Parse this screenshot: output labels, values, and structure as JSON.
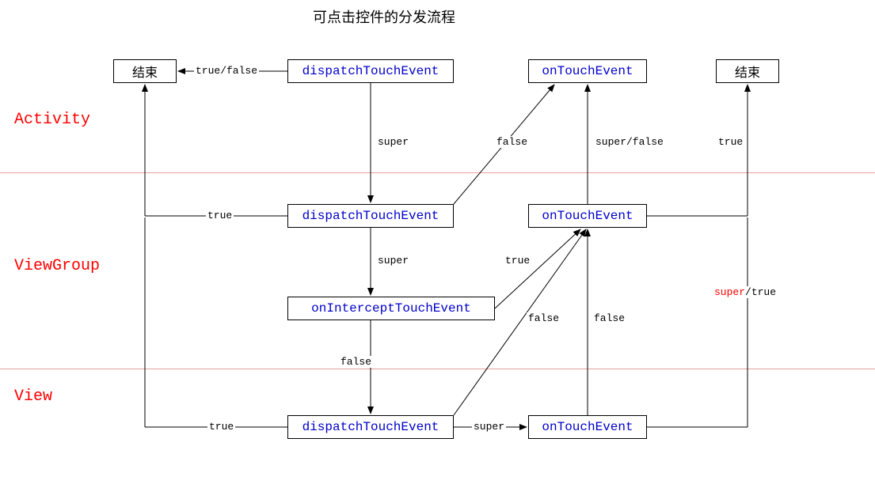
{
  "title": "可点击控件的分发流程",
  "layers": {
    "activity": "Activity",
    "viewgroup": "ViewGroup",
    "view": "View"
  },
  "nodes": {
    "end_left": "结束",
    "end_right": "结束",
    "act_dispatch": "dispatchTouchEvent",
    "act_on_touch": "onTouchEvent",
    "vg_dispatch": "dispatchTouchEvent",
    "vg_intercept": "onInterceptTouchEvent",
    "vg_on_touch": "onTouchEvent",
    "view_dispatch": "dispatchTouchEvent",
    "view_on_touch": "onTouchEvent"
  },
  "edges": {
    "true_false": "true/false",
    "super1": "super",
    "false1": "false",
    "super_false": "super/false",
    "true_top_right": "true",
    "true_vg_left": "true",
    "super2": "super",
    "true_intercept": "true",
    "super_true": "/true",
    "super_true_red": "super",
    "false_intercept": "false",
    "false_vg_right": "false",
    "true_view_left": "true",
    "super3": "super",
    "false_view": "false"
  }
}
